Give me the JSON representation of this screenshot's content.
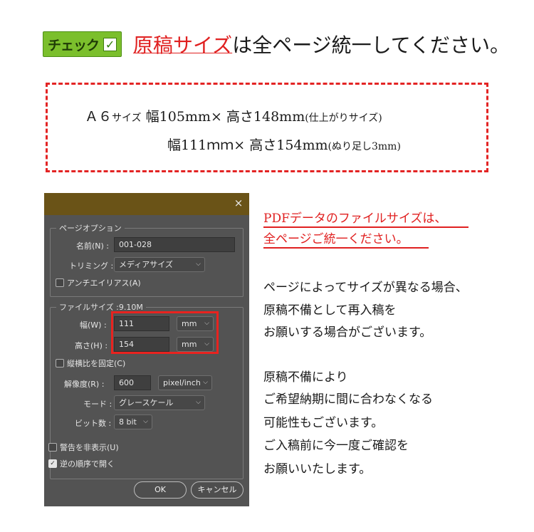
{
  "header": {
    "badge_text": "チェック",
    "badge_check": "✓",
    "title_highlight": "原稿サイズ",
    "title_rest": "は全ページ統一してください。"
  },
  "info_box": {
    "line1_prefix": "Ａ６",
    "line1_small": "サイズ",
    "line1_main": "  幅105mm× 高さ148mm",
    "line1_note": "(仕上がりサイズ)",
    "line2_main": "幅111ｍｍ× 高さ154mm",
    "line2_note": "(ぬり足し3mm)"
  },
  "dialog": {
    "close": "×",
    "page_options_legend": "ページオプション",
    "name_label": "名前(N) :",
    "name_value": "001-028",
    "trimming_label": "トリミング :",
    "trimming_value": "メディアサイズ",
    "antialias_label": "アンチエイリアス(A)",
    "antialias_checked": false,
    "filesize_legend": "ファイルサイズ :9.10M",
    "width_label": "幅(W) :",
    "width_value": "111",
    "width_unit": "mm",
    "height_label": "高さ(H) :",
    "height_value": "154",
    "height_unit": "mm",
    "constrain_label": "縦横比を固定(C)",
    "constrain_checked": false,
    "resolution_label": "解像度(R) :",
    "resolution_value": "600",
    "resolution_unit": "pixel/inch",
    "mode_label": "モード :",
    "mode_value": "グレースケール",
    "bitdepth_label": "ビット数 :",
    "bitdepth_value": "8 bit",
    "suppress_warnings_label": "警告を非表示(U)",
    "suppress_warnings_checked": false,
    "reverse_order_label": "逆の順序で開く",
    "reverse_order_checked": true,
    "ok_label": "OK",
    "cancel_label": "キャンセル"
  },
  "right_text": {
    "red_line1": "PDFデータのファイルサイズは、",
    "red_line2": "全ページご統一ください。",
    "para1_line1": "ページによってサイズが異なる場合、",
    "para1_line2": "原稿不備として再入稿を",
    "para1_line3": "お願いする場合がございます。",
    "para2_line1": "原稿不備により",
    "para2_line2": "ご希望納期に間に合わなくなる",
    "para2_line3": "可能性もございます。",
    "para2_line4": "ご入稿前に今一度ご確認を",
    "para2_line5": "お願いいたします。"
  },
  "colors": {
    "accent_red": "#e02020",
    "badge_green": "#7bbf2c",
    "dialog_bg": "#535353",
    "titlebar": "#6a5317"
  }
}
